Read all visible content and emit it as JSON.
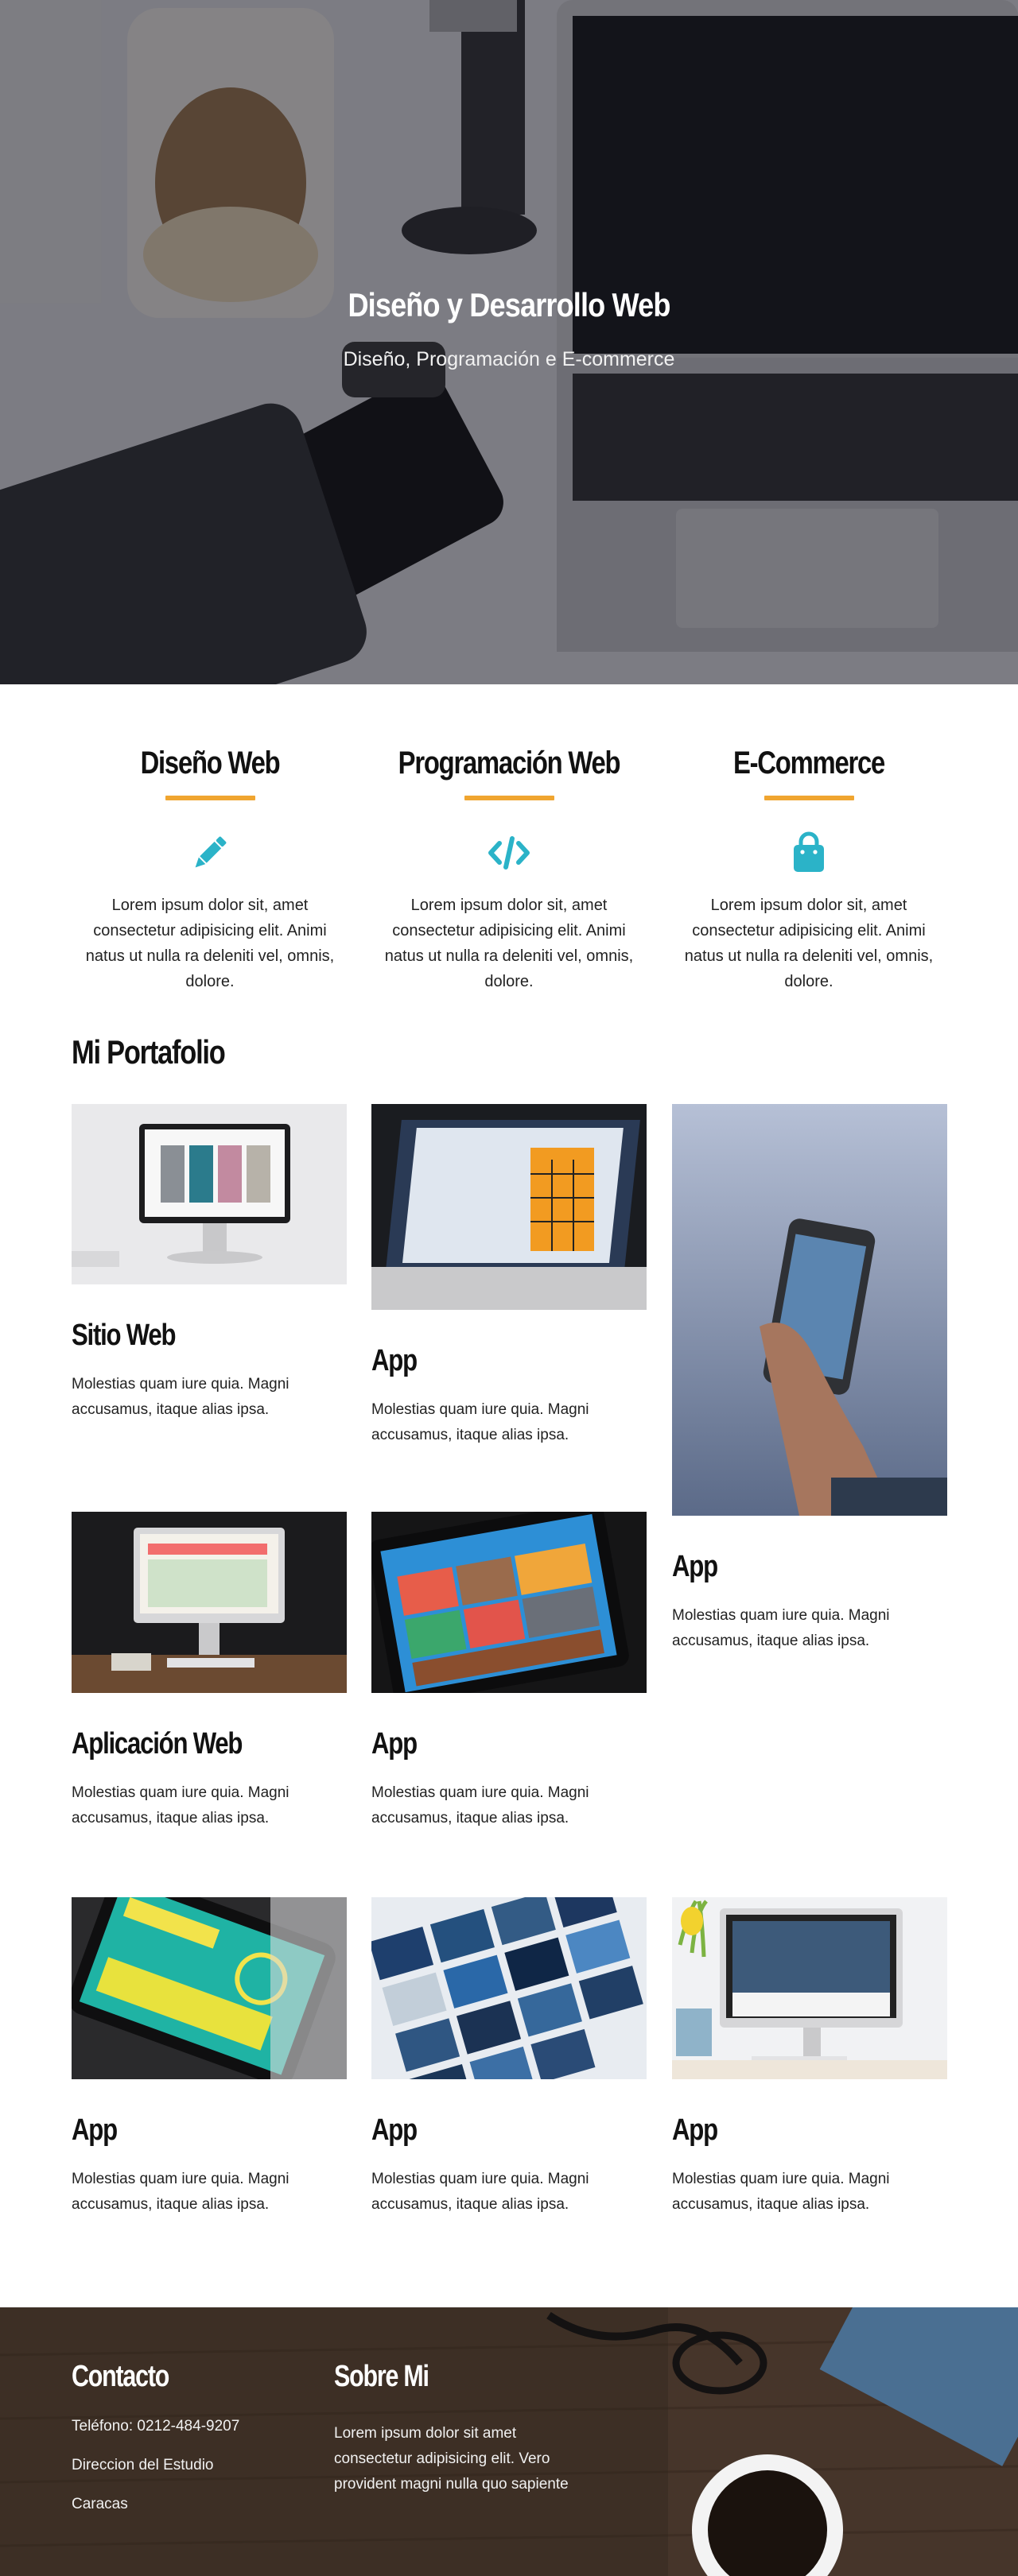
{
  "hero": {
    "title": "Diseño y Desarrollo Web",
    "subtitle": "Diseño, Programación e E-commerce"
  },
  "services": [
    {
      "title": "Diseño Web",
      "icon": "pencil-icon",
      "text": "Lorem ipsum dolor sit, amet consectetur adipisicing elit. Animi natus ut nulla ra deleniti vel, omnis, dolore."
    },
    {
      "title": "Programación Web",
      "icon": "code-icon",
      "text": "Lorem ipsum dolor sit, amet consectetur adipisicing elit. Animi natus ut nulla ra deleniti vel, omnis, dolore."
    },
    {
      "title": "E-Commerce",
      "icon": "shopping-bag-icon",
      "text": "Lorem ipsum dolor sit, amet consectetur adipisicing elit. Animi natus ut nulla ra deleniti vel, omnis, dolore."
    }
  ],
  "portfolio": {
    "heading": "Mi Portafolio",
    "items": [
      {
        "title": "Sitio Web",
        "text": "Molestias quam iure quia. Magni accusamus, itaque alias ipsa."
      },
      {
        "title": "App",
        "text": "Molestias quam iure quia. Magni accusamus, itaque alias ipsa."
      },
      {
        "title": "App",
        "text": "Molestias quam iure quia. Magni accusamus, itaque alias ipsa."
      },
      {
        "title": "Aplicación Web",
        "text": "Molestias quam iure quia. Magni accusamus, itaque alias ipsa."
      },
      {
        "title": "App",
        "text": "Molestias quam iure quia. Magni accusamus, itaque alias ipsa."
      },
      {
        "title": "App",
        "text": "Molestias quam iure quia. Magni accusamus, itaque alias ipsa."
      },
      {
        "title": "App",
        "text": "Molestias quam iure quia. Magni accusamus, itaque alias ipsa."
      },
      {
        "title": "App",
        "text": "Molestias quam iure quia. Magni accusamus, itaque alias ipsa."
      }
    ]
  },
  "footer": {
    "contact_heading": "Contacto",
    "phone": "Teléfono: 0212-484-9207",
    "address": "Direccion del Estudio",
    "city": "Caracas",
    "about_heading": "Sobre Mi",
    "about_text": "Lorem ipsum dolor sit amet consectetur adipisicing elit. Vero provident magni nulla quo sapiente"
  },
  "colors": {
    "accent": "#f0a530",
    "icon": "#2bb3c8",
    "text": "#222222"
  }
}
